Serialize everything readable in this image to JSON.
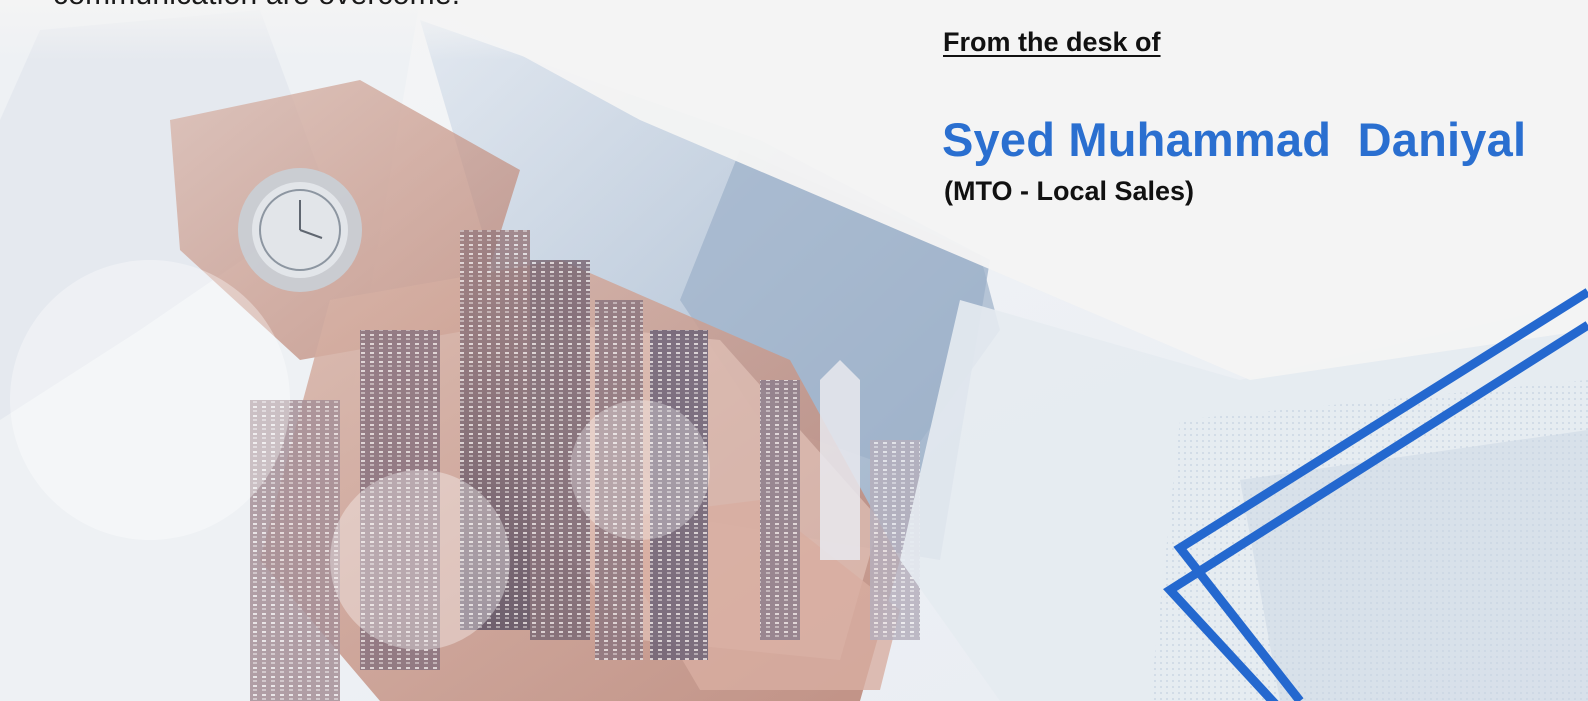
{
  "document": {
    "intro_fragment": "communication are overcome.",
    "desk_label": "From the desk of",
    "author_name": "Syed Muhammad  Daniyal",
    "author_role": "(MTO - Local Sales)"
  },
  "visuals": {
    "background_photo": "handshake-city-double-exposure",
    "accent_color": "#2a6fd0",
    "decor_lines": "blue-chevron-lines"
  }
}
